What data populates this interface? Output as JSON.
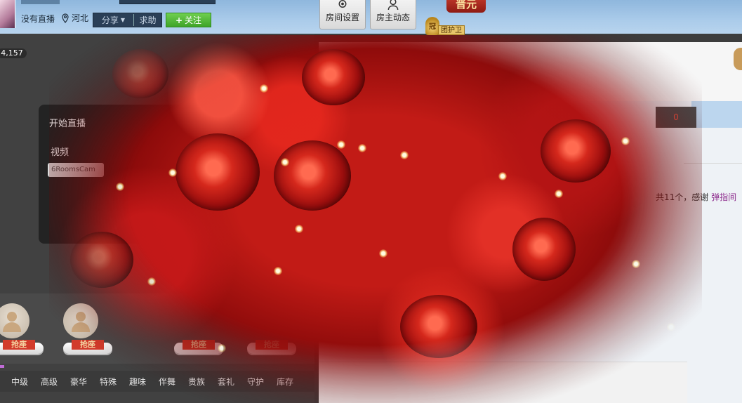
{
  "header": {
    "status_text": "没有直播",
    "location": "河北",
    "share_label": "分享",
    "help_label": "求助",
    "follow_label": "关注",
    "room_settings_label": "房间设置",
    "host_feed_label": "房主动态",
    "flag_text": "晋元",
    "guard_medal": "冠",
    "guard_label": "团护卫"
  },
  "left": {
    "audience_count": "4,157",
    "start_title": "开始直播",
    "video_label": "视频",
    "camera_name": "6RoomsCam",
    "seats": [
      {
        "label": "抢座"
      },
      {
        "label": "抢座"
      },
      {
        "label": "抢座"
      },
      {
        "label": "抢座"
      }
    ],
    "gift_tabs": [
      "中级",
      "高级",
      "豪华",
      "特殊",
      "趣味",
      "伴舞",
      "贵族",
      "套礼",
      "守护",
      "库存"
    ]
  },
  "right": {
    "badge_value": "0",
    "thanks_text": "共11个，感谢",
    "thanks_link": "弹指间"
  },
  "colors": {
    "follow_green": "#4cb832",
    "seat_red": "#d23b2b",
    "link_purple": "#8e2e8e",
    "overlay_red": "#c21b16"
  }
}
